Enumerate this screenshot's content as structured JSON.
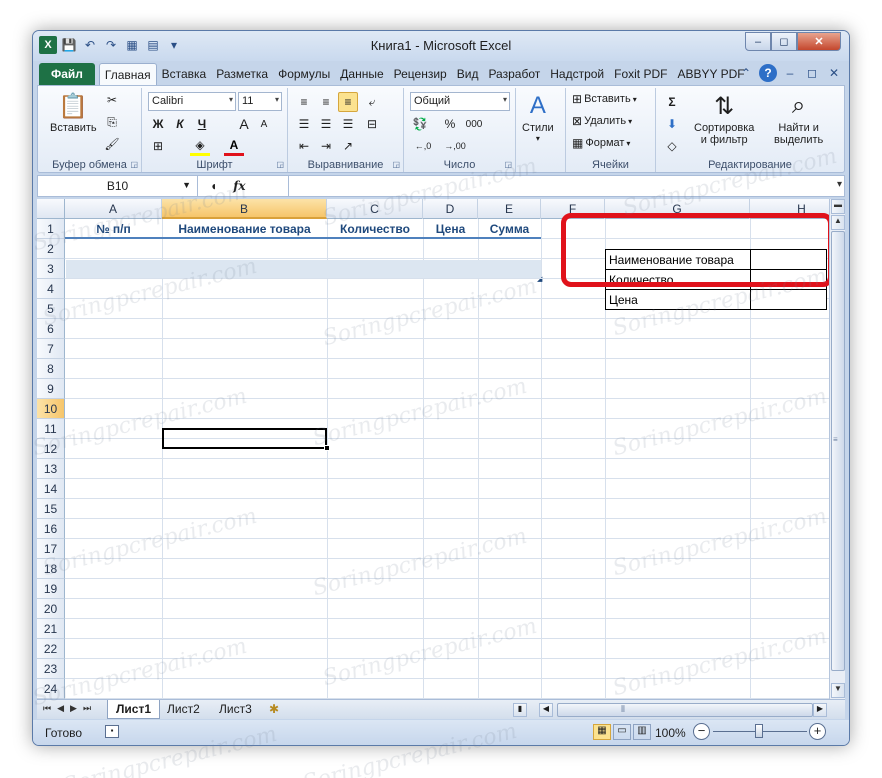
{
  "window": {
    "title": "Книга1 - Microsoft Excel",
    "controls": {
      "minimize": "–",
      "restore": "◻",
      "close": "✕"
    }
  },
  "qat": {
    "logo": "X",
    "save": "💾",
    "undo": "↶",
    "redo": "↷",
    "extra1": "▦",
    "extra2": "▤",
    "customize": "▾"
  },
  "tabs": {
    "file": "Файл",
    "items": [
      "Главная",
      "Вставка",
      "Разметка",
      "Формулы",
      "Данные",
      "Рецензир",
      "Вид",
      "Разработ",
      "Надстрой",
      "Foxit PDF",
      "ABBYY PDF"
    ],
    "right": {
      "collapse": "⌃",
      "help": "?",
      "min": "–",
      "restore": "◻",
      "close": "✕"
    }
  },
  "ribbon": {
    "clipboard": {
      "label": "Буфер обмена",
      "paste": "Вставить",
      "cut": "✂",
      "copy": "⎘",
      "painter": "🖌",
      "paste_icon": "📋"
    },
    "font": {
      "label": "Шрифт",
      "name": "Calibri",
      "size": "11",
      "bold": "Ж",
      "italic": "К",
      "underline": "Ч",
      "grow": "A",
      "shrink": "A",
      "borders": "⊞",
      "fill": "◈",
      "color": "A"
    },
    "alignment": {
      "label": "Выравнивание"
    },
    "number": {
      "label": "Число",
      "format": "Общий",
      "currency": "💱",
      "percent": "%",
      "thousands": "000",
      "inc": "←,0",
      "dec": "→,00"
    },
    "styles": {
      "label": "Стили"
    },
    "cells": {
      "label": "Ячейки",
      "insert": "Вставить",
      "delete": "Удалить",
      "format": "Формат"
    },
    "editing": {
      "label": "Редактирование",
      "sum": "Σ",
      "fill": "⬇",
      "clear": "◇",
      "sort": "Сортировка",
      "sort2": "и фильтр",
      "find": "Найти и",
      "find2": "выделить"
    }
  },
  "formula_bar": {
    "name_box": "B10",
    "fx": "fx",
    "value": ""
  },
  "columns": [
    "A",
    "B",
    "C",
    "D",
    "E",
    "F",
    "G",
    "H"
  ],
  "selected_column": "B",
  "rows": [
    "1",
    "2",
    "3",
    "4",
    "5",
    "6",
    "7",
    "8",
    "9",
    "10",
    "11",
    "12",
    "13",
    "14",
    "15",
    "16",
    "17",
    "18",
    "19",
    "20",
    "21",
    "22",
    "23",
    "24"
  ],
  "selected_row": "10",
  "table_headers": [
    "№ п/п",
    "Наименование товара",
    "Количество",
    "Цена",
    "Сумма"
  ],
  "side_table": [
    "Наименование товара",
    "Количество",
    "Цена"
  ],
  "sheets": {
    "tabs": [
      "Лист1",
      "Лист2",
      "Лист3"
    ],
    "active": "Лист1",
    "new_icon": "✱"
  },
  "status": {
    "ready": "Готово",
    "zoom": "100%"
  },
  "watermark": "Soringpcrepair.com",
  "colors": {
    "accent_file": "#1e7145",
    "highlight_frame": "#e0121b",
    "header_text": "#1f497d",
    "band": "#dce6f1"
  }
}
